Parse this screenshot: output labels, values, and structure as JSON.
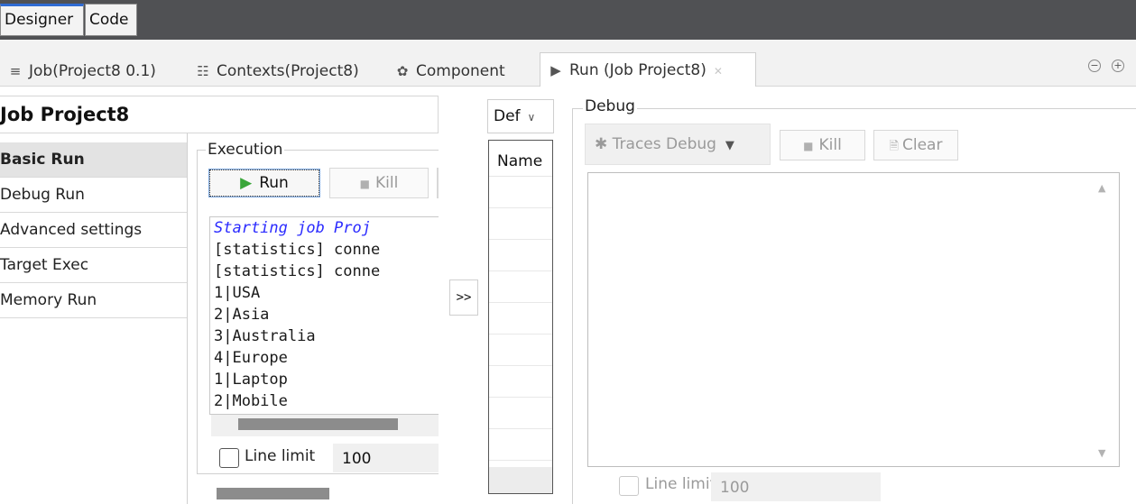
{
  "top_tabs": {
    "designer": "Designer",
    "code": "Code"
  },
  "tabs": [
    {
      "label": "Job(Project8 0.1)",
      "icon": "job-icon"
    },
    {
      "label": "Contexts(Project8)",
      "icon": "contexts-icon"
    },
    {
      "label": "Component",
      "icon": "component-icon"
    },
    {
      "label": "Run (Job Project8)",
      "icon": "run-icon"
    }
  ],
  "left": {
    "title": "Job Project8",
    "nav": [
      "Basic Run",
      "Debug Run",
      "Advanced settings",
      "Target Exec",
      "Memory Run"
    ],
    "execution_label": "Execution",
    "run_label": "Run",
    "kill_label": "Kill",
    "console_lines": [
      "Starting job Proj",
      "[statistics] conne",
      "[statistics] conne",
      "1|USA",
      "2|Asia",
      "3|Australia",
      "4|Europe",
      "1|Laptop",
      "2|Mobile"
    ],
    "line_limit_label": "Line limit",
    "line_limit_value": "100",
    "expand_label": ">>"
  },
  "vars": {
    "select_value": "Def",
    "column_header": "Name"
  },
  "debug": {
    "label": "Debug",
    "traces_label": "Traces Debug",
    "kill_label": "Kill",
    "clear_label": "Clear",
    "line_limit_label": "Line limit",
    "line_limit_value": "100"
  },
  "colors": {
    "accent": "#2f6bd3",
    "console_start": "#2b2bff",
    "run_icon": "#3aa63a"
  }
}
